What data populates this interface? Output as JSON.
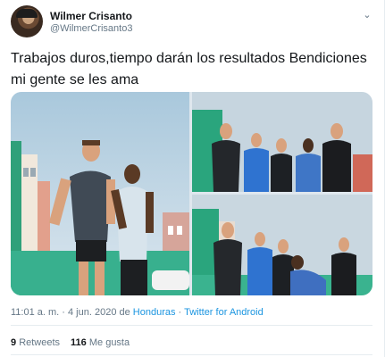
{
  "author": {
    "name": "Wilmer Crisanto",
    "handle": "@WilmerCrisanto3"
  },
  "tweet": {
    "text_line1": "Trabajos duros,tiempo darán los resultados Bendiciones",
    "text_line2": "mi gente se les ama",
    "time": "11:01 a. m.",
    "sep1": " · ",
    "date": "4 jun. 2020",
    "from": " de ",
    "location": "Honduras",
    "sep2": " · ",
    "client": "Twitter for Android"
  },
  "stats": {
    "retweets_count": "9",
    "retweets_label": "Retweets",
    "likes_count": "116",
    "likes_label": "Me gusta"
  },
  "icons": {
    "menu": "chevron-down-icon"
  },
  "colors": {
    "link": "#1b95e0",
    "secondary_text": "#657786",
    "divider": "#e6ecf0"
  }
}
